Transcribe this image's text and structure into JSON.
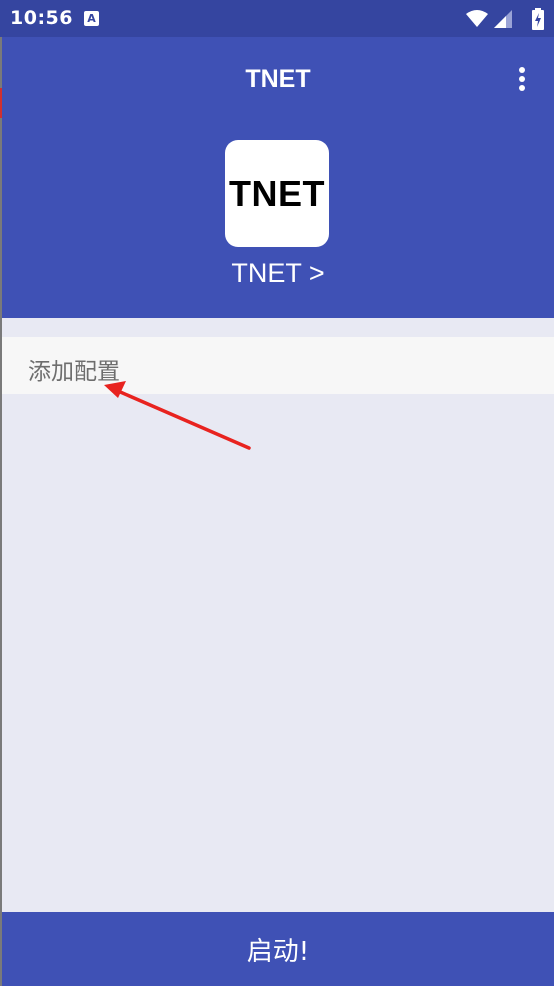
{
  "status_bar": {
    "time": "10:56",
    "notification_icon": "A"
  },
  "toolbar": {
    "title": "TNET",
    "menu_icon": "more-vert-icon"
  },
  "header": {
    "logo_text": "TNET",
    "app_link": "TNET >"
  },
  "config": {
    "add_label": "添加配置"
  },
  "footer": {
    "start_label": "启动!"
  },
  "colors": {
    "primary": "#3f51b5",
    "status_bar": "#3545a0",
    "background": "#e8e9f3",
    "annotation_arrow": "#e8231f"
  }
}
